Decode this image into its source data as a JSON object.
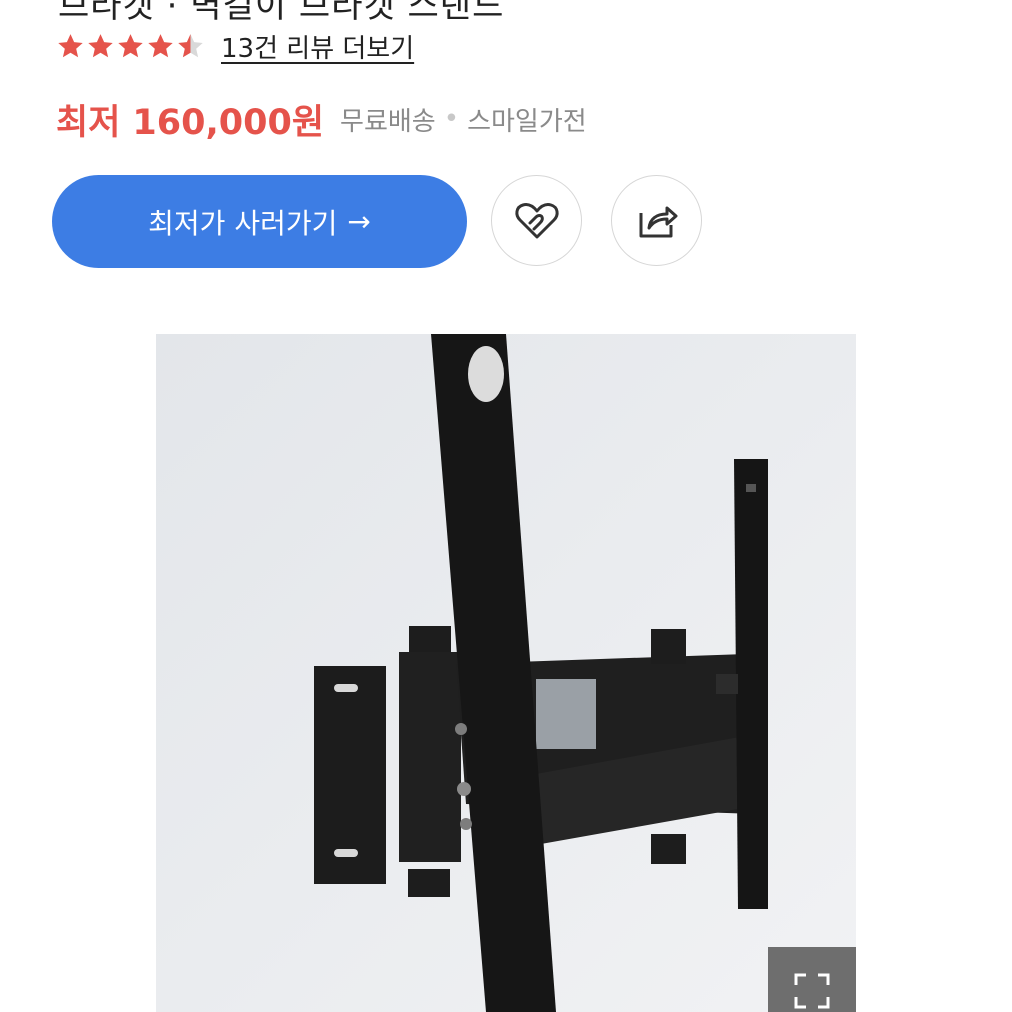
{
  "product": {
    "title_cut": "브라켓 · 벽걸이 브라켓 스탠드"
  },
  "rating": {
    "stars": 4.5,
    "review_link": "13건 리뷰 더보기"
  },
  "price": {
    "label": "최저",
    "value": "160,000원",
    "shipping": "무료배송",
    "separator": "•",
    "seller": "스마일가전"
  },
  "actions": {
    "buy_label": "최저가 사러가기",
    "buy_arrow": "→",
    "wishlist_icon": "heart-outline-icon",
    "share_icon": "share-arrow-icon"
  },
  "colors": {
    "accent": "#3d7de4",
    "price": "#e5534b",
    "star": "#e5534b",
    "muted": "#8a8a8a"
  },
  "image": {
    "alt": "TV 벽걸이 브라켓",
    "expand_icon": "expand-icon"
  }
}
